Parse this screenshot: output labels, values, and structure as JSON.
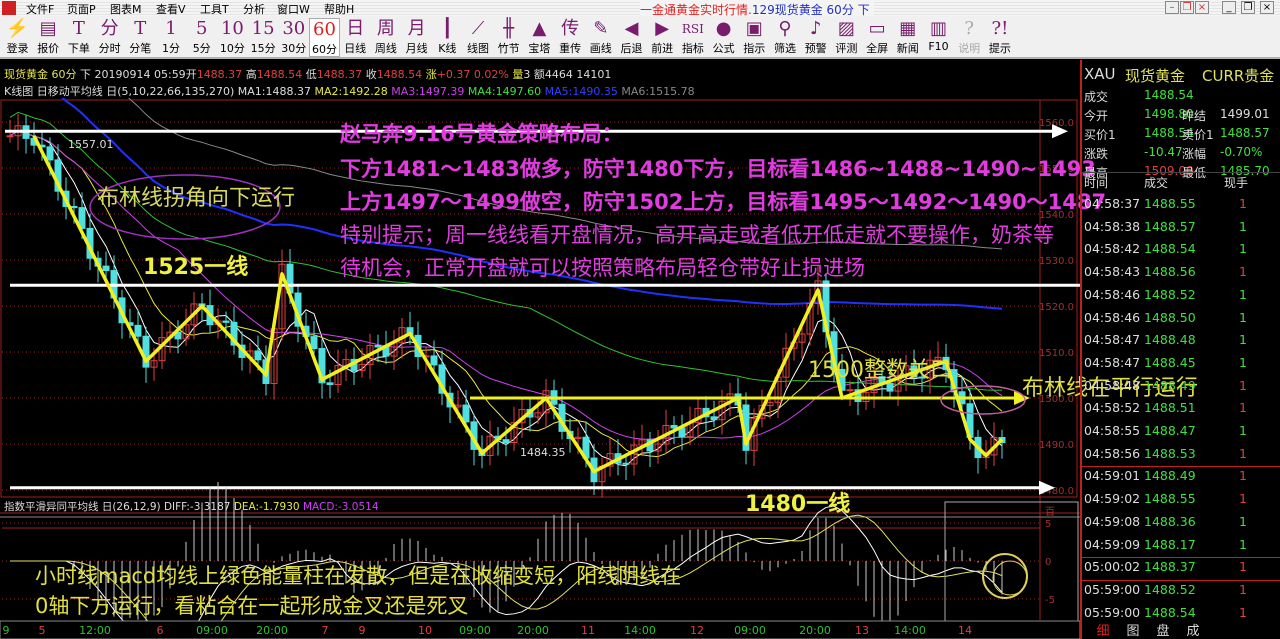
{
  "window": {
    "menu": [
      "文件F",
      "页面P",
      "图表M",
      "查看V",
      "工具T",
      "分析",
      "窗口W",
      "帮助H"
    ],
    "title_red": "一金通黄金实时行情.",
    "title_blue": "129现货黄金 60分 下",
    "buttons": [
      "minimize",
      "restore",
      "close",
      "app-minimize",
      "app-restore",
      "app-close"
    ]
  },
  "toolbar": [
    {
      "icon": "login-icon",
      "glyph": "⚡",
      "label": "登录"
    },
    {
      "icon": "quote-icon",
      "glyph": "▤",
      "label": "报价"
    },
    {
      "icon": "order-icon",
      "glyph": "T",
      "label": "下单"
    },
    {
      "icon": "intraday-icon",
      "glyph": "分",
      "label": "分时"
    },
    {
      "icon": "tick-icon",
      "glyph": "T",
      "label": "分笔"
    },
    {
      "icon": "1min-icon",
      "glyph": "1",
      "label": "1分"
    },
    {
      "icon": "5min-icon",
      "glyph": "5",
      "label": "5分"
    },
    {
      "icon": "10min-icon",
      "glyph": "10",
      "label": "10分"
    },
    {
      "icon": "15min-icon",
      "glyph": "15",
      "label": "15分"
    },
    {
      "icon": "30min-icon",
      "glyph": "30",
      "label": "30分"
    },
    {
      "icon": "60min-icon",
      "glyph": "60",
      "label": "60分",
      "selected": true
    },
    {
      "icon": "daily-icon",
      "glyph": "日",
      "label": "日线"
    },
    {
      "icon": "weekly-icon",
      "glyph": "周",
      "label": "周线"
    },
    {
      "icon": "monthly-icon",
      "glyph": "月",
      "label": "月线"
    },
    {
      "icon": "candlestick-icon",
      "glyph": "┃",
      "label": "K线"
    },
    {
      "icon": "line-chart-icon",
      "glyph": "⟋",
      "label": "线图"
    },
    {
      "icon": "bamboo-icon",
      "glyph": "╫",
      "label": "竹节"
    },
    {
      "icon": "tower-icon",
      "glyph": "▲",
      "label": "宝塔"
    },
    {
      "icon": "reload-icon",
      "glyph": "传",
      "label": "重传"
    },
    {
      "icon": "pencil-icon",
      "glyph": "✎",
      "label": "画线"
    },
    {
      "icon": "back-icon",
      "glyph": "◀",
      "label": "后退"
    },
    {
      "icon": "forward-icon",
      "glyph": "▶",
      "label": "前进"
    },
    {
      "icon": "rsi-icon",
      "glyph": "RSI",
      "label": "指标"
    },
    {
      "icon": "formula-icon",
      "glyph": "●",
      "label": "公式"
    },
    {
      "icon": "indicator-icon",
      "glyph": "▣",
      "label": "指示"
    },
    {
      "icon": "binoculars-icon",
      "glyph": "⚲",
      "label": "筛选"
    },
    {
      "icon": "alert-bell-icon",
      "glyph": "♪",
      "label": "预警"
    },
    {
      "icon": "evaluate-icon",
      "glyph": "▨",
      "label": "评测"
    },
    {
      "icon": "fullscreen-icon",
      "glyph": "▭",
      "label": "全屏"
    },
    {
      "icon": "news-icon",
      "glyph": "▦",
      "label": "新闻"
    },
    {
      "icon": "books-icon",
      "glyph": "▥",
      "label": "F10"
    },
    {
      "icon": "help-icon",
      "glyph": "?",
      "label": "说明",
      "disabled": true
    },
    {
      "icon": "tips-icon",
      "glyph": "?!",
      "label": "提示"
    }
  ],
  "info": {
    "symbol": "现货黄金",
    "period": "60分",
    "dir": "下",
    "datetime": "20190914 05:59",
    "open_label": "开",
    "open": "1488.37",
    "high_label": "高",
    "high": "1488.54",
    "low_label": "低",
    "low": "1488.37",
    "close_label": "收",
    "close": "1488.54",
    "chg_label": "涨",
    "chg": "+0.37",
    "chg_pct": "0.02%",
    "vol_label": "量",
    "vol": "3",
    "amt_label": "额",
    "amt": "4464 14101"
  },
  "ma": {
    "title": "K线图 日移动平均线 日(5,10,22,66,135,270)",
    "ma1": "MA1:1488.37",
    "ma2": "MA2:1492.28",
    "ma3": "MA3:1497.39",
    "ma4": "MA4:1497.60",
    "ma5": "MA5:1490.35",
    "ma6": "MA6:1515.78"
  },
  "chart": {
    "price_axis": [
      "1560.0",
      "1550.0",
      "1540.0",
      "1530.0",
      "1520.0",
      "1510.0",
      "1500.0",
      "1490.0",
      "1480.0"
    ],
    "price_range": [
      1480,
      1560
    ],
    "zigzag": [
      [
        3,
        1557
      ],
      [
        17,
        1508
      ],
      [
        24,
        1520
      ],
      [
        32,
        1505
      ],
      [
        34,
        1527
      ],
      [
        39,
        1504
      ],
      [
        50,
        1514
      ],
      [
        59,
        1488
      ],
      [
        67,
        1500
      ],
      [
        73,
        1484
      ],
      [
        91,
        1500
      ],
      [
        92,
        1490
      ],
      [
        101,
        1523.5
      ],
      [
        104,
        1500
      ],
      [
        117,
        1508
      ],
      [
        120,
        1491
      ],
      [
        122,
        1487.5
      ],
      [
        124,
        1491
      ]
    ],
    "levels": [
      1558,
      1524.5,
      1480.5
    ],
    "level_1500": 1500,
    "high_mark": "1557.01",
    "low_mark": "1484.35",
    "colors": {
      "up": "#e04040",
      "down": "#50e0e0",
      "zigzag": "#f0f020",
      "ma1": "#ffffff",
      "ma2": "#e8e840",
      "ma3": "#d040f0",
      "ma4": "#30c030",
      "ma5": "#2030ff",
      "ma6": "#888888"
    },
    "time_axis": [
      {
        "t": "9",
        "c": "g"
      },
      {
        "t": "5",
        "c": "r"
      },
      {
        "t": "12:00",
        "c": "g"
      },
      {
        "t": "6",
        "c": "r"
      },
      {
        "t": "09:00",
        "c": "g"
      },
      {
        "t": "20:00",
        "c": "g"
      },
      {
        "t": "7",
        "c": "r"
      },
      {
        "t": "9",
        "c": "r"
      },
      {
        "t": "10",
        "c": "r"
      },
      {
        "t": "09:00",
        "c": "g"
      },
      {
        "t": "20:00",
        "c": "g"
      },
      {
        "t": "11",
        "c": "r"
      },
      {
        "t": "14:00",
        "c": "g"
      },
      {
        "t": "12",
        "c": "r"
      },
      {
        "t": "09:00",
        "c": "g"
      },
      {
        "t": "20:00",
        "c": "g"
      },
      {
        "t": "13",
        "c": "r"
      },
      {
        "t": "14:00",
        "c": "g"
      },
      {
        "t": "14",
        "c": "r"
      }
    ]
  },
  "annotations": {
    "bollinger_down": "布林线拐角向下运行",
    "line_1525": "1525一线",
    "strategy": [
      "赵马奔9.16号黄金策略布局：",
      "下方1481～1483做多，防守1480下方，目标看1486~1488~1490~1493",
      "上方1497～1499做空，防守1502上方，目标看1495～1492～1490～1487",
      "特别提示；周一线线看开盘情况，高开高走或者低开低走就不要操作，奶茶等",
      "待机会，正常开盘就可以按照策略布局轻仓带好止损进场"
    ],
    "level_1500": "1500整数关口",
    "bollinger_flat": "布林线在平行运行",
    "line_1480": "1480一线",
    "macd_note": [
      "小时线macd均线上绿色能量柱在发散，但是在收缩变短，阳线阴线在",
      "0轴下方运行，看粘合在一起形成金叉还是死叉"
    ]
  },
  "macd": {
    "title": "指数平滑异同平均线 日(26,12,9)",
    "diff": "DIFF:-3.3187",
    "dea": "DEA:-1.7930",
    "macd": "MACD:-3.0514",
    "axis": [
      "百",
      "5",
      "0",
      "-5"
    ]
  },
  "quote": {
    "code": "XAU",
    "name": "现货黄金",
    "market": "CURR贵金",
    "rows": [
      {
        "l1": "成交",
        "v1": "1488.54"
      },
      {
        "l1": "今开",
        "v1": "1498.80",
        "l2": "昨结",
        "v2": "1499.01"
      },
      {
        "l1": "买价1",
        "v1": "1488.54",
        "l2": "卖价1",
        "v2": "1488.57"
      },
      {
        "l1": "涨跌",
        "v1": "-10.47",
        "l2": "涨幅",
        "v2": "-0.70%"
      },
      {
        "l1": "最高",
        "v1": "1509.00",
        "l2": "最低",
        "v2": "1485.70"
      }
    ],
    "tick_headers": [
      "时间",
      "成交",
      "现手"
    ],
    "ticks": [
      {
        "t": "04:58:37",
        "p": "1488.55",
        "v": "1",
        "c": "r"
      },
      {
        "t": "04:58:38",
        "p": "1488.57",
        "v": "1",
        "c": "g"
      },
      {
        "t": "04:58:42",
        "p": "1488.54",
        "v": "1",
        "c": "g"
      },
      {
        "t": "04:58:43",
        "p": "1488.56",
        "v": "1",
        "c": "r"
      },
      {
        "t": "04:58:46",
        "p": "1488.52",
        "v": "1",
        "c": "g"
      },
      {
        "t": "04:58:46",
        "p": "1488.50",
        "v": "1",
        "c": "g"
      },
      {
        "t": "04:58:47",
        "p": "1488.48",
        "v": "1",
        "c": "g"
      },
      {
        "t": "04:58:47",
        "p": "1488.45",
        "v": "1",
        "c": "g"
      },
      {
        "t": "04:58:48",
        "p": "1488.49",
        "v": "1",
        "c": "r"
      },
      {
        "t": "04:58:52",
        "p": "1488.51",
        "v": "1",
        "c": "r"
      },
      {
        "t": "04:58:55",
        "p": "1488.47",
        "v": "1",
        "c": "g"
      },
      {
        "t": "04:58:56",
        "p": "1488.53",
        "v": "1",
        "c": "r"
      },
      {
        "t": "04:59:01",
        "p": "1488.49",
        "v": "1",
        "c": "r"
      },
      {
        "t": "04:59:02",
        "p": "1488.55",
        "v": "1",
        "c": "r"
      },
      {
        "t": "04:59:08",
        "p": "1488.36",
        "v": "1",
        "c": "g"
      },
      {
        "t": "04:59:09",
        "p": "1488.17",
        "v": "1",
        "c": "g"
      },
      {
        "t": "05:00:02",
        "p": "1488.37",
        "v": "1",
        "c": "r"
      },
      {
        "t": "05:59:00",
        "p": "1488.52",
        "v": "1",
        "c": "r"
      },
      {
        "t": "05:59:00",
        "p": "1488.54",
        "v": "1",
        "c": "r"
      }
    ],
    "tabs": [
      "细",
      "图",
      "盘",
      "成"
    ]
  }
}
